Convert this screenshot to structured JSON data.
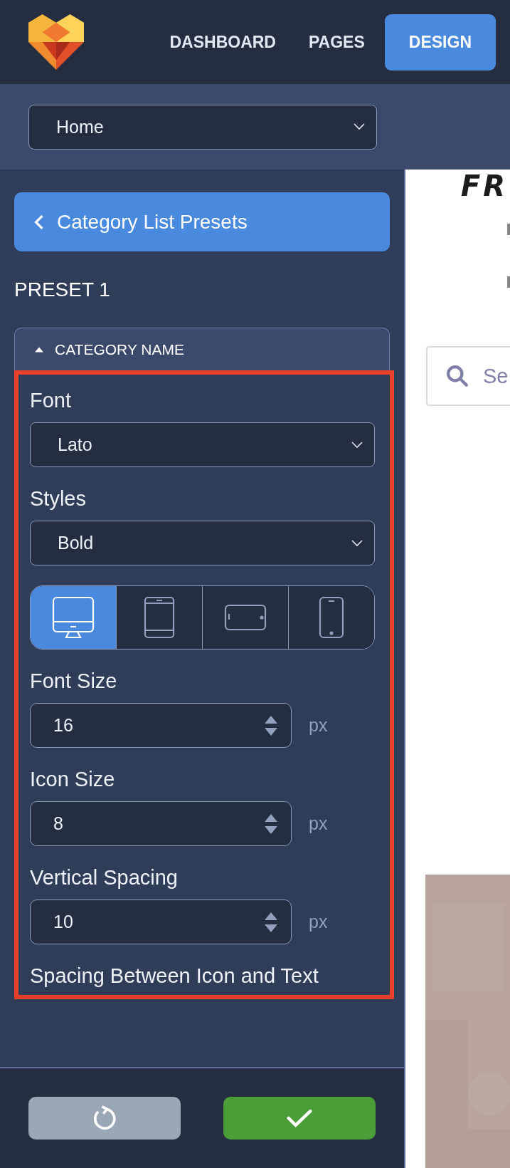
{
  "nav": {
    "items": [
      {
        "label": "DASHBOARD",
        "selected": false
      },
      {
        "label": "PAGES",
        "selected": false
      },
      {
        "label": "DESIGN",
        "selected": true
      }
    ]
  },
  "page_select": {
    "value": "Home"
  },
  "back_button": {
    "label": "Category List Presets"
  },
  "preset_title": "PRESET 1",
  "section": {
    "title": "CATEGORY NAME",
    "expanded": true
  },
  "fields": [
    {
      "kind": "select",
      "label": "Font",
      "value": "Lato"
    },
    {
      "kind": "select",
      "label": "Styles",
      "value": "Bold"
    },
    {
      "kind": "devices",
      "devices": [
        {
          "kind": "desktop",
          "selected": true
        },
        {
          "kind": "tablet",
          "selected": false
        },
        {
          "kind": "tablet-landscape",
          "selected": false
        },
        {
          "kind": "phone",
          "selected": false
        }
      ]
    },
    {
      "kind": "number",
      "label": "Font Size",
      "value": "16",
      "unit": "px"
    },
    {
      "kind": "number",
      "label": "Icon Size",
      "value": "8",
      "unit": "px"
    },
    {
      "kind": "number",
      "label": "Vertical Spacing",
      "value": "10",
      "unit": "px"
    },
    {
      "kind": "label",
      "label": "Spacing Between Icon and Text"
    }
  ],
  "preview": {
    "logo_text": "FR",
    "search_placeholder": "Se"
  }
}
